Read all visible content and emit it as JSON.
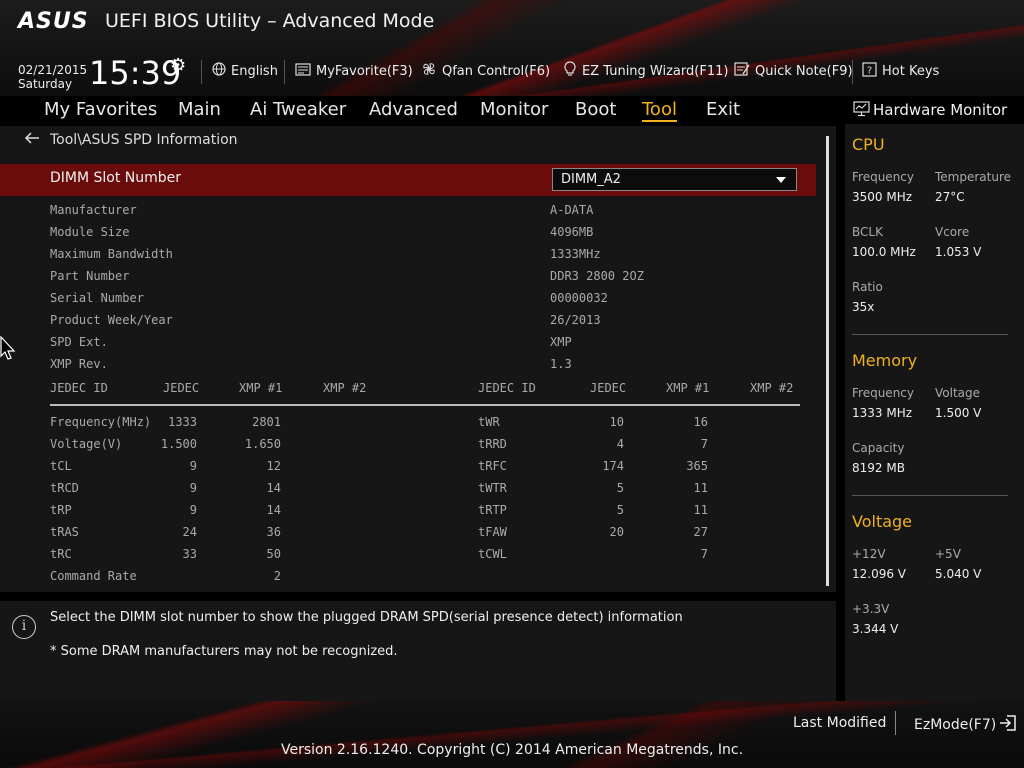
{
  "header": {
    "brand": "ASUS",
    "title": "UEFI BIOS Utility – Advanced Mode",
    "date": "02/21/2015",
    "day": "Saturday",
    "time": "15:39",
    "toolbar": [
      {
        "label": "English",
        "icon": "globe-icon"
      },
      {
        "label": "MyFavorite(F3)",
        "icon": "favorite-icon"
      },
      {
        "label": "Qfan Control(F6)",
        "icon": "fan-icon"
      },
      {
        "label": "EZ Tuning Wizard(F11)",
        "icon": "bulb-icon"
      },
      {
        "label": "Quick Note(F9)",
        "icon": "note-icon"
      },
      {
        "label": "Hot Keys",
        "icon": "question-icon"
      }
    ]
  },
  "nav": {
    "tabs": [
      "My Favorites",
      "Main",
      "Ai Tweaker",
      "Advanced",
      "Monitor",
      "Boot",
      "Tool",
      "Exit"
    ],
    "active": "Tool"
  },
  "main": {
    "breadcrumb": "Tool\\ASUS SPD Information",
    "slot_label": "DIMM Slot Number",
    "slot_value": "DIMM_A2",
    "info": [
      {
        "key": "Manufacturer",
        "value": "A-DATA"
      },
      {
        "key": "Module Size",
        "value": "4096MB"
      },
      {
        "key": "Maximum Bandwidth",
        "value": "1333MHz"
      },
      {
        "key": "Part Number",
        "value": "DDR3 2800 2OZ"
      },
      {
        "key": "Serial Number",
        "value": "00000032"
      },
      {
        "key": "Product Week/Year",
        "value": "26/2013"
      },
      {
        "key": "SPD Ext.",
        "value": "XMP"
      },
      {
        "key": "XMP Rev.",
        "value": "1.3"
      }
    ],
    "table_headers": [
      "JEDEC ID",
      "JEDEC",
      "XMP #1",
      "XMP #2"
    ],
    "left_rows": [
      {
        "name": "Frequency(MHz)",
        "jedec": "1333",
        "xmp1": "2801",
        "xmp2": ""
      },
      {
        "name": "Voltage(V)",
        "jedec": "1.500",
        "xmp1": "1.650",
        "xmp2": ""
      },
      {
        "name": "tCL",
        "jedec": "9",
        "xmp1": "12",
        "xmp2": ""
      },
      {
        "name": "tRCD",
        "jedec": "9",
        "xmp1": "14",
        "xmp2": ""
      },
      {
        "name": "tRP",
        "jedec": "9",
        "xmp1": "14",
        "xmp2": ""
      },
      {
        "name": "tRAS",
        "jedec": "24",
        "xmp1": "36",
        "xmp2": ""
      },
      {
        "name": "tRC",
        "jedec": "33",
        "xmp1": "50",
        "xmp2": ""
      },
      {
        "name": "Command Rate",
        "jedec": "",
        "xmp1": "2",
        "xmp2": ""
      }
    ],
    "right_rows": [
      {
        "name": "tWR",
        "jedec": "10",
        "xmp1": "16",
        "xmp2": ""
      },
      {
        "name": "tRRD",
        "jedec": "4",
        "xmp1": "7",
        "xmp2": ""
      },
      {
        "name": "tRFC",
        "jedec": "174",
        "xmp1": "365",
        "xmp2": ""
      },
      {
        "name": "tWTR",
        "jedec": "5",
        "xmp1": "11",
        "xmp2": ""
      },
      {
        "name": "tRTP",
        "jedec": "5",
        "xmp1": "11",
        "xmp2": ""
      },
      {
        "name": "tFAW",
        "jedec": "20",
        "xmp1": "27",
        "xmp2": ""
      },
      {
        "name": "tCWL",
        "jedec": "",
        "xmp1": "7",
        "xmp2": ""
      }
    ]
  },
  "help": {
    "line1": "Select the DIMM slot number to show the plugged DRAM SPD(serial presence detect) information",
    "line2": "* Some DRAM manufacturers may not be recognized."
  },
  "hwmon": {
    "title": "Hardware Monitor",
    "cpu": {
      "heading": "CPU",
      "frequency_label": "Frequency",
      "frequency": "3500 MHz",
      "temperature_label": "Temperature",
      "temperature": "27°C",
      "bclk_label": "BCLK",
      "bclk": "100.0 MHz",
      "vcore_label": "Vcore",
      "vcore": "1.053 V",
      "ratio_label": "Ratio",
      "ratio": "35x"
    },
    "memory": {
      "heading": "Memory",
      "frequency_label": "Frequency",
      "frequency": "1333 MHz",
      "voltage_label": "Voltage",
      "voltage": "1.500 V",
      "capacity_label": "Capacity",
      "capacity": "8192 MB"
    },
    "voltage": {
      "heading": "Voltage",
      "v12_label": "+12V",
      "v12": "12.096 V",
      "v5_label": "+5V",
      "v5": "5.040 V",
      "v33_label": "+3.3V",
      "v33": "3.344 V"
    }
  },
  "footer": {
    "last_modified": "Last Modified",
    "ezmode": "EzMode(F7)",
    "copyright": "Version 2.16.1240. Copyright (C) 2014 American Megatrends, Inc."
  },
  "colors": {
    "accent": "#f0b020",
    "selected_row": "#6b0c0c",
    "panel": "#161616"
  }
}
